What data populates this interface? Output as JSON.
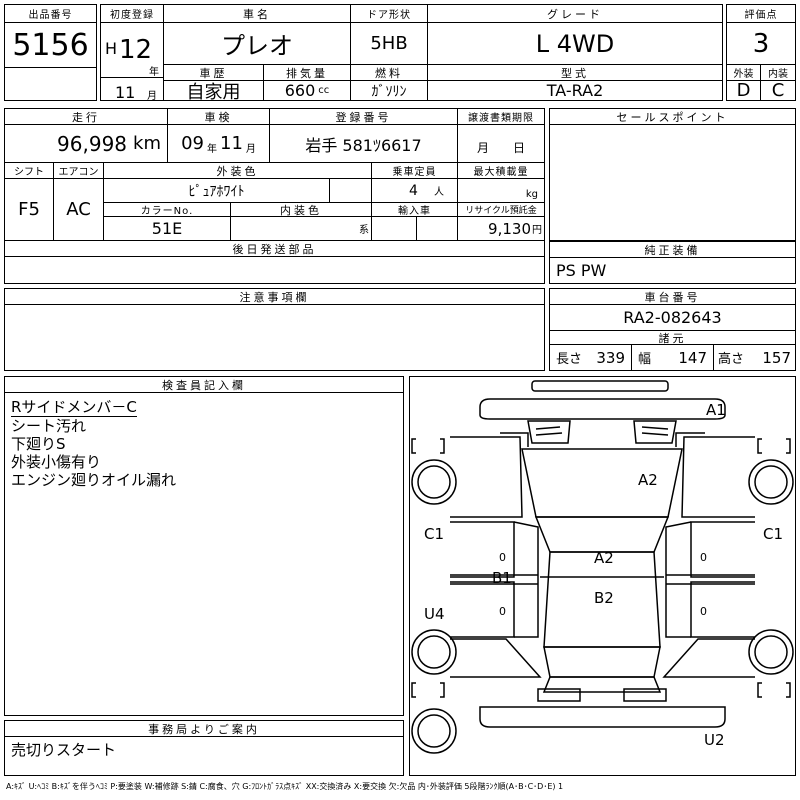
{
  "header": {
    "lot_label": "出品番号",
    "lot_no": "5156",
    "first_reg_label": "初度登録",
    "era": "H",
    "year": "12",
    "year_unit": "年",
    "month": "11",
    "month_unit": "月",
    "car_name_label": "車名",
    "car_name": "プレオ",
    "door_label": "ドア形状",
    "door": "5HB",
    "grade_label": "グレード",
    "grade": "L 4WD",
    "score_label": "評価点",
    "score": "3",
    "history_label": "車歴",
    "history": "自家用",
    "displacement_label": "排気量",
    "displacement": "660",
    "displacement_unit": "cc",
    "fuel_label": "燃料",
    "fuel": "ｶﾞｿﾘﾝ",
    "model_label": "型式",
    "model": "TA-RA2",
    "exterior_label": "外装",
    "exterior": "D",
    "interior_label": "内装",
    "interior": "C"
  },
  "specs": {
    "mileage_label": "走行",
    "mileage": "96,998",
    "mileage_unit": "km",
    "inspection_label": "車検",
    "insp_year": "09",
    "insp_year_unit": "年",
    "insp_month": "11",
    "insp_month_unit": "月",
    "reg_no_label": "登録番号",
    "reg_no": "岩手 581ﾂ6617",
    "transfer_label": "譲渡書類期限",
    "transfer_month": "月",
    "transfer_day": "日",
    "shift_label": "シフト",
    "shift": "F5",
    "ac_label": "エアコン",
    "ac": "AC",
    "ext_color_label": "外装色",
    "ext_color": "ﾋﾟｭｱﾎﾜｲﾄ",
    "capacity_label": "乗車定員",
    "capacity": "4",
    "capacity_unit": "人",
    "max_load_label": "最大積載量",
    "max_load_unit": "kg",
    "color_no_label": "カラーNo.",
    "color_no": "51E",
    "int_color_label": "内装色",
    "int_color_unit": "系",
    "import_label": "輸入車",
    "recycle_label": "リサイクル預託金",
    "recycle": "9,130",
    "recycle_unit": "円",
    "later_parts_label": "後日発送部品"
  },
  "sales_points": {
    "label": "セールスポイント"
  },
  "equipment": {
    "label": "純正装備",
    "value": "PS PW"
  },
  "notes": {
    "label": "注意事項欄"
  },
  "chassis": {
    "label": "車台番号",
    "value": "RA2-082643",
    "dims_label": "諸元",
    "length_label": "長さ",
    "length": "339",
    "width_label": "幅",
    "width": "147",
    "height_label": "高さ",
    "height": "157"
  },
  "inspector": {
    "label": "検査員記入欄",
    "lines": [
      "Rサイドメンバ－C",
      "シート汚れ",
      "下廻りS",
      "外装小傷有り",
      "エンジン廻りオイル漏れ"
    ]
  },
  "diagram": {
    "marks": {
      "a1": "A1",
      "a2_hood": "A2",
      "c1_left": "C1",
      "c1_right": "C1",
      "a2_roof": "A2",
      "b1": "B1",
      "b2": "B2",
      "u4": "U4",
      "u2": "U2",
      "z1": "0",
      "z2": "0",
      "z3": "0",
      "z4": "0"
    }
  },
  "office": {
    "label": "事務局よりご案内",
    "text": "売切りスタート"
  },
  "legend": "A:ｷｽﾞ U:ﾍｺﾐ B:ｷｽﾞを伴うﾍｺﾐ P:要塗装 W:補修跡 S:錆 C:腐食、穴 G:ﾌﾛﾝﾄｶﾞﾗｽ点ｷｽﾞ XX:交換済み X:要交換 欠:欠品 内･外装評価 5段階ﾗﾝｸ順(A･B･C･D･E) 1"
}
